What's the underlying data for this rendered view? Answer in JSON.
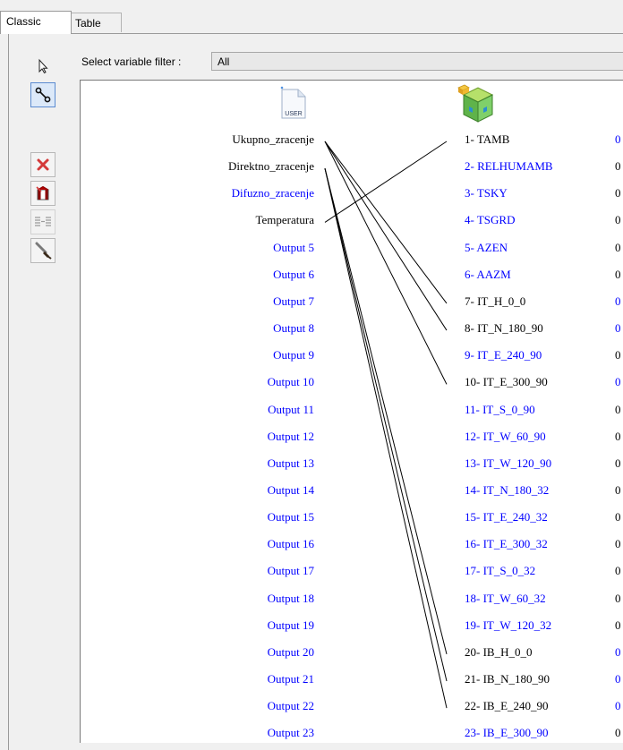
{
  "tabs": [
    {
      "label": "Classic",
      "active": true
    },
    {
      "label": "Table",
      "active": false
    }
  ],
  "toolbar": {
    "tools": [
      {
        "name": "pointer-icon",
        "pressed": false
      },
      {
        "name": "link-tool-icon",
        "pressed": true
      },
      {
        "name": "delete-icon",
        "pressed": false
      },
      {
        "name": "delete-all-icon",
        "pressed": false
      },
      {
        "name": "auto-link-icon",
        "pressed": false
      },
      {
        "name": "brush-icon",
        "pressed": false
      }
    ]
  },
  "filter": {
    "label": "Select variable filter :",
    "value": "All"
  },
  "source": {
    "icon_label": "USER",
    "outputs": [
      {
        "label": "Ukupno_zracenje",
        "connected": true
      },
      {
        "label": "Direktno_zracenje",
        "connected": true
      },
      {
        "label": "Difuzno_zracenje",
        "connected": false
      },
      {
        "label": "Temperatura",
        "connected": true
      },
      {
        "label": "Output 5",
        "connected": false
      },
      {
        "label": "Output 6",
        "connected": false
      },
      {
        "label": "Output 7",
        "connected": false
      },
      {
        "label": "Output 8",
        "connected": false
      },
      {
        "label": "Output 9",
        "connected": false
      },
      {
        "label": "Output 10",
        "connected": false
      },
      {
        "label": "Output 11",
        "connected": false
      },
      {
        "label": "Output 12",
        "connected": false
      },
      {
        "label": "Output 13",
        "connected": false
      },
      {
        "label": "Output 14",
        "connected": false
      },
      {
        "label": "Output 15",
        "connected": false
      },
      {
        "label": "Output 16",
        "connected": false
      },
      {
        "label": "Output 17",
        "connected": false
      },
      {
        "label": "Output 18",
        "connected": false
      },
      {
        "label": "Output 19",
        "connected": false
      },
      {
        "label": "Output 20",
        "connected": false
      },
      {
        "label": "Output 21",
        "connected": false
      },
      {
        "label": "Output 22",
        "connected": false
      },
      {
        "label": "Output 23",
        "connected": false
      }
    ]
  },
  "target": {
    "inputs": [
      {
        "label": "1- TAMB",
        "connected": true,
        "extra": "0"
      },
      {
        "label": "2- RELHUMAMB",
        "connected": false,
        "extra": "0"
      },
      {
        "label": "3- TSKY",
        "connected": false,
        "extra": "0"
      },
      {
        "label": "4- TSGRD",
        "connected": false,
        "extra": "0"
      },
      {
        "label": "5- AZEN",
        "connected": false,
        "extra": "0"
      },
      {
        "label": "6- AAZM",
        "connected": false,
        "extra": "0"
      },
      {
        "label": "7- IT_H_0_0",
        "connected": true,
        "extra": "0"
      },
      {
        "label": "8- IT_N_180_90",
        "connected": true,
        "extra": "0"
      },
      {
        "label": "9- IT_E_240_90",
        "connected": false,
        "extra": "0"
      },
      {
        "label": "10- IT_E_300_90",
        "connected": true,
        "extra": "0"
      },
      {
        "label": "11- IT_S_0_90",
        "connected": false,
        "extra": "0"
      },
      {
        "label": "12- IT_W_60_90",
        "connected": false,
        "extra": "0"
      },
      {
        "label": "13- IT_W_120_90",
        "connected": false,
        "extra": "0"
      },
      {
        "label": "14- IT_N_180_32",
        "connected": false,
        "extra": "0"
      },
      {
        "label": "15- IT_E_240_32",
        "connected": false,
        "extra": "0"
      },
      {
        "label": "16- IT_E_300_32",
        "connected": false,
        "extra": "0"
      },
      {
        "label": "17- IT_S_0_32",
        "connected": false,
        "extra": "0"
      },
      {
        "label": "18- IT_W_60_32",
        "connected": false,
        "extra": "0"
      },
      {
        "label": "19- IT_W_120_32",
        "connected": false,
        "extra": "0"
      },
      {
        "label": "20- IB_H_0_0",
        "connected": true,
        "extra": "0"
      },
      {
        "label": "21- IB_N_180_90",
        "connected": true,
        "extra": "0"
      },
      {
        "label": "22- IB_E_240_90",
        "connected": true,
        "extra": "0"
      },
      {
        "label": "23- IB_E_300_90",
        "connected": false,
        "extra": "0"
      }
    ]
  },
  "connections": [
    {
      "from": "Ukupno_zracenje",
      "to": "7- IT_H_0_0"
    },
    {
      "from": "Ukupno_zracenje",
      "to": "8- IT_N_180_90"
    },
    {
      "from": "Ukupno_zracenje",
      "to": "10- IT_E_300_90"
    },
    {
      "from": "Direktno_zracenje",
      "to": "20- IB_H_0_0"
    },
    {
      "from": "Direktno_zracenje",
      "to": "21- IB_N_180_90"
    },
    {
      "from": "Direktno_zracenje",
      "to": "22- IB_E_240_90"
    },
    {
      "from": "Temperatura",
      "to": "1- TAMB"
    }
  ],
  "colors": {
    "linked": "#000000",
    "unlinked": "#0000ff",
    "wire": "#000000"
  }
}
